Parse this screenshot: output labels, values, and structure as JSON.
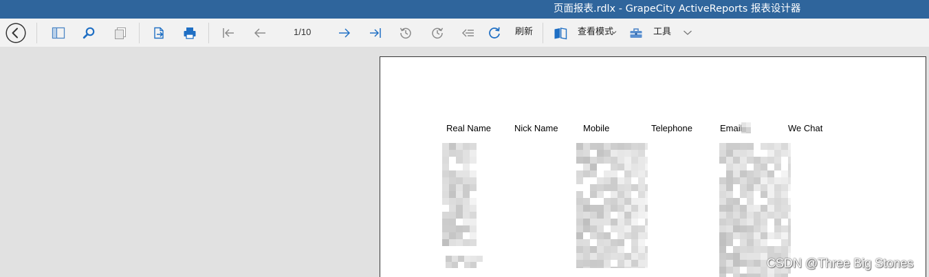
{
  "window": {
    "title": "页面报表.rdlx - GrapeCity ActiveReports 报表设计器"
  },
  "toolbar": {
    "page_indicator": "1/10",
    "refresh_label": "刷新",
    "view_mode_label": "查看模式",
    "tools_label": "工具",
    "icons": [
      "back-icon",
      "sidebar-toggle-icon",
      "search-icon",
      "copy-pages-icon",
      "export-page-icon",
      "print-icon",
      "first-page-icon",
      "previous-page-icon",
      "next-page-icon",
      "last-page-icon",
      "history-back-icon",
      "history-forward-icon",
      "back-to-parent-icon",
      "refresh-icon",
      "view-mode-book-icon",
      "view-mode-chevron-icon",
      "toolbox-icon",
      "tools-chevron-down-icon"
    ]
  },
  "report": {
    "columns": [
      "Real Name",
      "Nick Name",
      "Mobile",
      "Telephone",
      "Email",
      "We Chat"
    ]
  },
  "watermark": "CSDN @Three Big Stones",
  "colors": {
    "title_bar": "#2f659c",
    "toolbar_bg": "#f2f2f2",
    "workspace_bg": "#e1e1e1",
    "accent_icon": "#1f6fc4",
    "disabled_icon": "#8a8a8a",
    "page_bg": "#ffffff"
  }
}
